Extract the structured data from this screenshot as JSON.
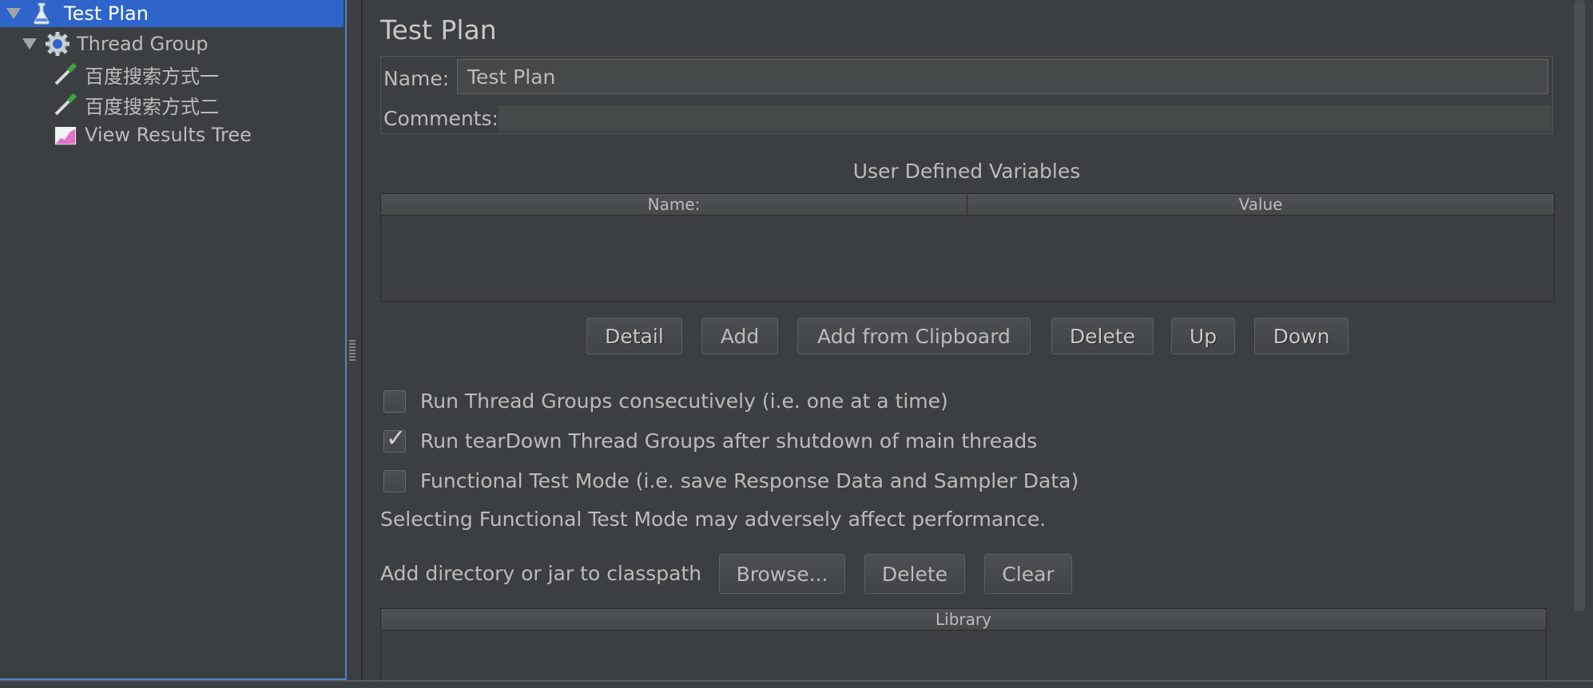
{
  "tree": {
    "items": [
      {
        "label": "Test Plan",
        "icon": "test-plan-icon",
        "selected": true,
        "expanded": true
      },
      {
        "label": "Thread Group",
        "icon": "gear-icon",
        "selected": false,
        "expanded": true
      },
      {
        "label": "百度搜索方式一",
        "icon": "pipette-sampler-icon",
        "selected": false
      },
      {
        "label": "百度搜索方式二",
        "icon": "pipette-sampler-icon",
        "selected": false
      },
      {
        "label": "View Results Tree",
        "icon": "graph-listener-icon",
        "selected": false
      }
    ]
  },
  "main": {
    "title": "Test Plan",
    "name_label": "Name:",
    "name_value": "Test Plan",
    "comments_label": "Comments:",
    "comments_value": "",
    "udv": {
      "title": "User Defined Variables",
      "columns": [
        "Name:",
        "Value"
      ],
      "buttons": [
        "Detail",
        "Add",
        "Add from Clipboard",
        "Delete",
        "Up",
        "Down"
      ]
    },
    "options": [
      {
        "label": "Run Thread Groups consecutively (i.e. one at a time)",
        "checked": false
      },
      {
        "label": "Run tearDown Thread Groups after shutdown of main threads",
        "checked": true
      },
      {
        "label": "Functional Test Mode (i.e. save Response Data and Sampler Data)",
        "checked": false
      }
    ],
    "functional_note": "Selecting Functional Test Mode may adversely affect performance.",
    "classpath": {
      "label": "Add directory or jar to classpath",
      "buttons": [
        "Browse...",
        "Delete",
        "Clear"
      ],
      "columns": [
        "Library"
      ]
    }
  },
  "colors": {
    "background": "#3c3f41",
    "selection": "#2f65ca",
    "text": "#bbbbbb"
  }
}
